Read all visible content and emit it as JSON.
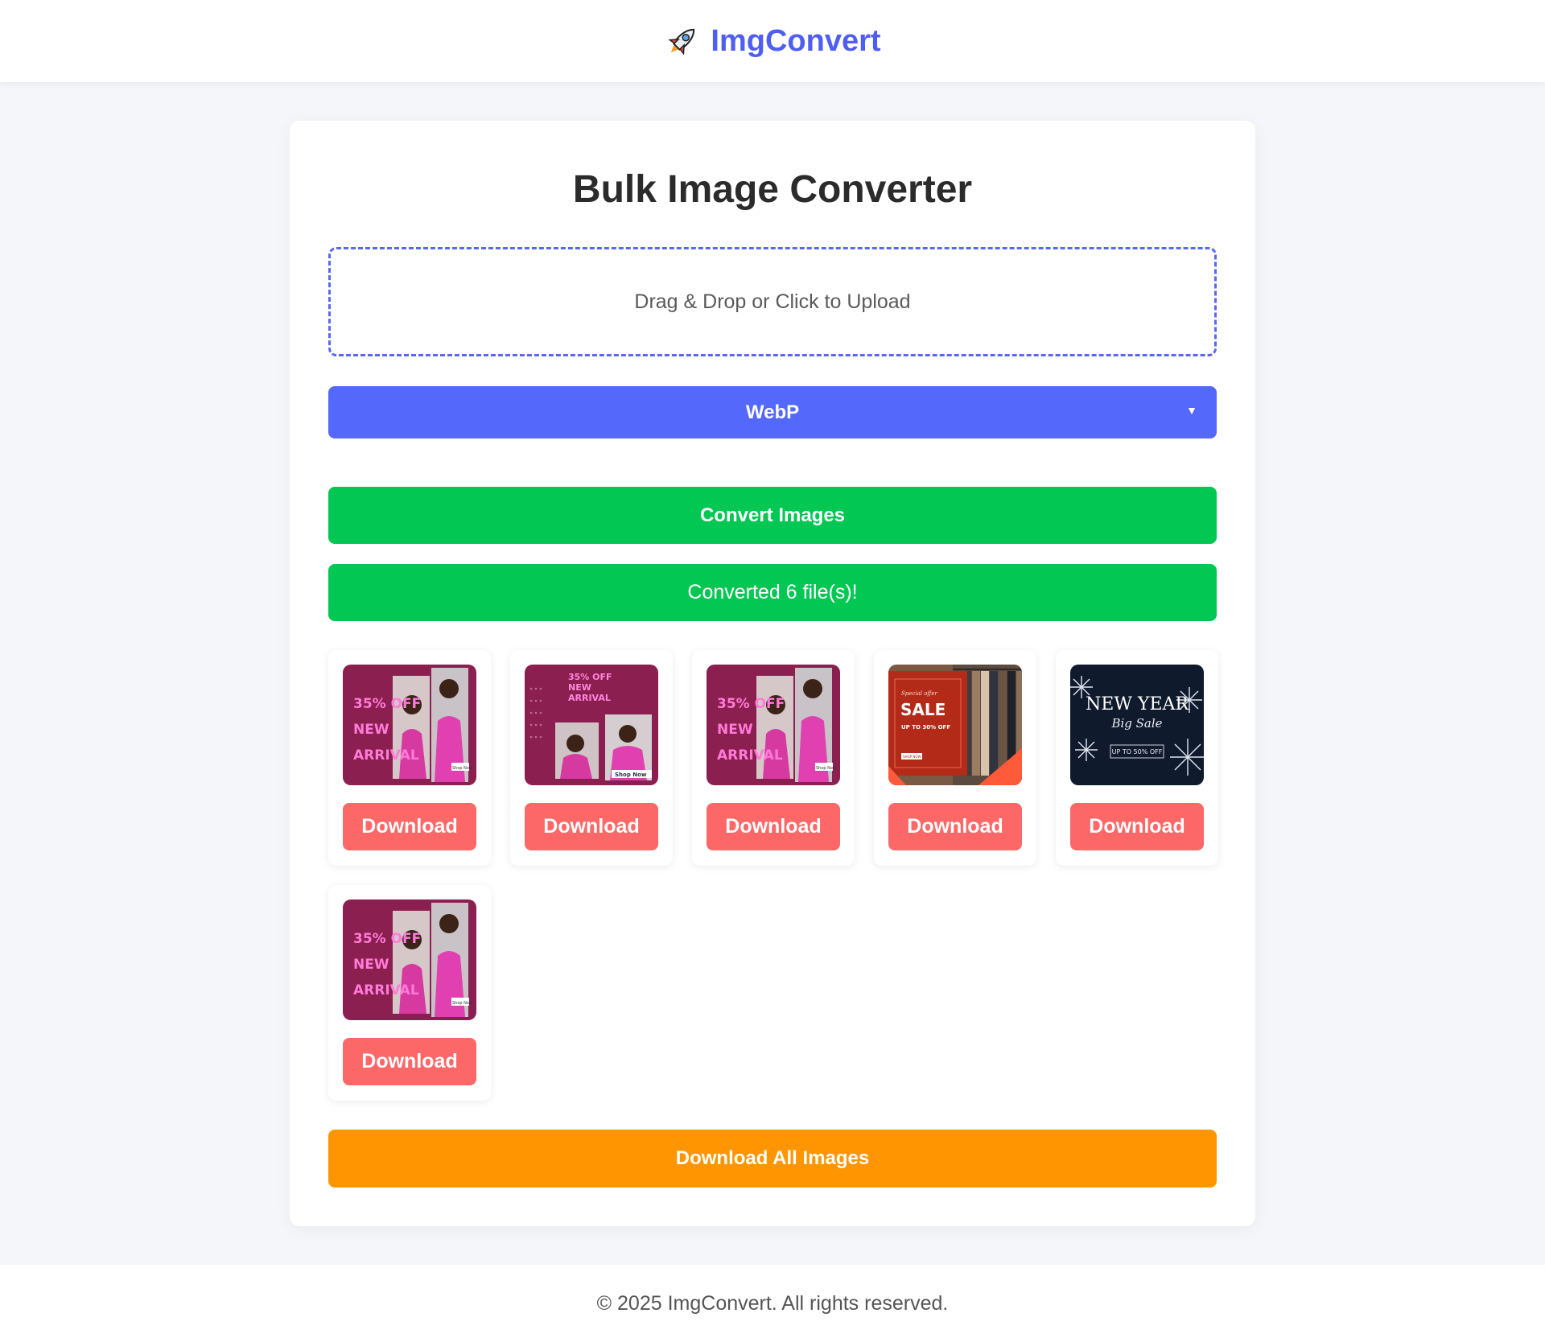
{
  "header": {
    "brand": "ImgConvert",
    "logo_icon": "rocket-icon"
  },
  "main": {
    "title": "Bulk Image Converter",
    "dropzone_label": "Drag & Drop or Click to Upload",
    "format_select": {
      "selected": "WebP"
    },
    "convert_label": "Convert Images",
    "status_message": "Converted 6 file(s)!",
    "results": [
      {
        "thumbnail": "arrival-pink-banner",
        "button_label": "Download"
      },
      {
        "thumbnail": "arrival-pink-banner-alt",
        "button_label": "Download"
      },
      {
        "thumbnail": "arrival-pink-banner",
        "button_label": "Download"
      },
      {
        "thumbnail": "special-sale-banner",
        "button_label": "Download"
      },
      {
        "thumbnail": "new-year-sale-banner",
        "button_label": "Download"
      },
      {
        "thumbnail": "arrival-pink-banner",
        "button_label": "Download"
      }
    ],
    "download_all_label": "Download All Images"
  },
  "thumb_text": {
    "arrival": {
      "line1": "35% OFF",
      "line2": "NEW",
      "line3": "ARRIVAL",
      "tag": "Shop Now"
    },
    "arrival_alt": {
      "line1": "35% OFF",
      "line2": "NEW",
      "line3": "ARRIVAL",
      "tag": "Shop Now"
    },
    "sale": {
      "kicker": "Special offer",
      "headline": "SALE",
      "sub": "UP TO 30% OFF",
      "tag": "SHOP NOW"
    },
    "newyear": {
      "line1": "NEW YEAR",
      "line2": "Big Sale",
      "sub": "UP TO 50% OFF"
    }
  },
  "footer": {
    "copyright": "© 2025 ImgConvert. All rights reserved."
  },
  "colors": {
    "brand": "#4f5ef2",
    "select_bg": "#5469fb",
    "success": "#02c853",
    "download": "#fc6868",
    "download_all": "#ff9601",
    "thumb_pink": "#8b1f4f",
    "thumb_navy": "#0f1a2c",
    "thumb_red": "#b32a18"
  }
}
